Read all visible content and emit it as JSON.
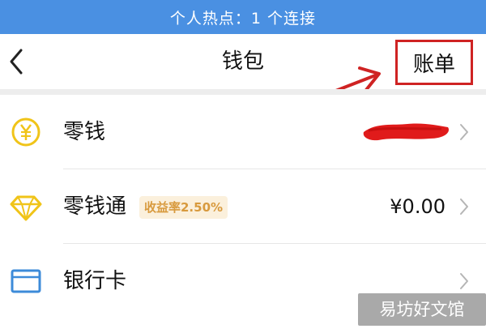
{
  "status_bar": {
    "hotspot_text": "个人热点：1 个连接",
    "color": "#4a90e2"
  },
  "nav": {
    "back_icon": "chevron-left-icon",
    "title": "钱包",
    "bill_label": "账单",
    "annotation_color": "#cf2323"
  },
  "rows": [
    {
      "icon": "coin-yen-icon",
      "label": "零钱",
      "value_redacted": true
    },
    {
      "icon": "diamond-icon",
      "label": "零钱通",
      "badge": "收益率2.50%",
      "value": "¥0.00"
    },
    {
      "icon": "bank-card-icon",
      "label": "银行卡"
    }
  ],
  "watermark": "易坊好文馆",
  "colors": {
    "gold": "#f0c419",
    "card_blue": "#3d8bd9",
    "badge_text": "#d89a3e",
    "badge_bg": "#fbf0dc"
  }
}
